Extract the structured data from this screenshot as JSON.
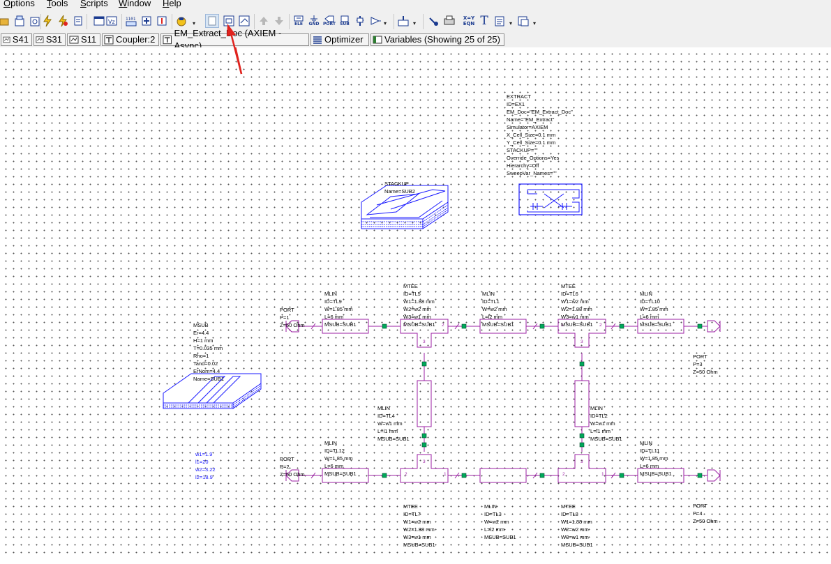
{
  "menu": [
    "Options",
    "Tools",
    "Scripts",
    "Window",
    "Help"
  ],
  "toolbar": {
    "ele_label": "ELE",
    "gnd_label": "GND",
    "port_label": "PORT",
    "sub_label": "SUB",
    "eqn_label": "X=Y\nEQN",
    "text_label": "T"
  },
  "tabs": [
    {
      "label": "S41"
    },
    {
      "label": "S31"
    },
    {
      "label": "S11"
    },
    {
      "label": "Coupler:2"
    },
    {
      "label": "EM_Extract_Doc (AXIEM - Async)"
    },
    {
      "label": "Optimizer"
    },
    {
      "label": "Variables (Showing 25 of 25)"
    }
  ],
  "colors": {
    "wire": "#9b1fa3",
    "node": "#00a85a",
    "em": "#1a1aff",
    "arrow": "#e0231e"
  },
  "schematic": {
    "extract": [
      "EXTRACT",
      "ID=EX1",
      "EM_Doc=\"EM_Extract_Doc\"",
      "Name=\"EM_Extract\"",
      "Simulator=AXIEM",
      "X_Cell_Size=0.1 mm",
      "Y_Cell_Size=0.1 mm",
      "STACKUP=\"\"",
      "Override_Options=Yes",
      "Hierarchy=Off",
      "SweepVar_Names=\"\""
    ],
    "stackup": [
      "STACKUP",
      "Name=SUB2"
    ],
    "msub": [
      "MSUB",
      "Er=4.4",
      "H=1 mm",
      "T=0.035 mm",
      "Rho=1",
      "Tand=0.02",
      "ErNom=4.4",
      "Name=SUB1"
    ],
    "vars": [
      "w1=1.9",
      "l1=20",
      "w2=3.22",
      "l2=18.9"
    ],
    "port1": [
      "PORT",
      "P=1",
      "Z=50 Ohm"
    ],
    "port2": [
      "PORT",
      "P=2",
      "Z=50 Ohm"
    ],
    "port3": [
      "PORT",
      "P=3",
      "Z=50 Ohm"
    ],
    "port4": [
      "PORT",
      "P=4",
      "Z=50 Ohm"
    ],
    "tl9": [
      "MLIN",
      "ID=TL9",
      "W=1.85 mm",
      "L=6 mm",
      "MSUB=SUB1"
    ],
    "tl5": [
      "MTEE",
      "ID=TL5",
      "W1=1.88 mm",
      "W2=w2 mm",
      "W3=w1 mm",
      "MSUB=SUB1"
    ],
    "tl1": [
      "MLIN",
      "ID=TL1",
      "W=w2 mm",
      "L=l2 mm",
      "MSUB=SUB1"
    ],
    "tl6": [
      "MTEE",
      "ID=TL6",
      "W1=w2 mm",
      "W2=1.88 mm",
      "W3=w1 mm",
      "MSUB=SUB1"
    ],
    "tl10": [
      "MLIN",
      "ID=TL10",
      "W=1.85 mm",
      "L=6 mm",
      "MSUB=SUB1"
    ],
    "tl4": [
      "MLIN",
      "ID=TL4",
      "W=w1 mm",
      "L=l1 mm",
      "MSUB=SUB1"
    ],
    "tl2": [
      "MLIN",
      "ID=TL2",
      "W=w1 mm",
      "L=l1 mm",
      "MSUB=SUB1"
    ],
    "tl12": [
      "MLIN",
      "ID=TL12",
      "W=1.85 mm",
      "L=6 mm",
      "MSUB=SUB1"
    ],
    "tl11": [
      "MLIN",
      "ID=TL11",
      "W=1.85 mm",
      "L=6 mm",
      "MSUB=SUB1"
    ],
    "tl7": [
      "MTEE",
      "ID=TL7",
      "W1=w2 mm",
      "W2=1.88 mm",
      "W3=w1 mm",
      "MSUB=SUB1"
    ],
    "tl3": [
      "MLIN",
      "ID=TL3",
      "W=w2 mm",
      "L=l2 mm",
      "MSUB=SUB1"
    ],
    "tl8": [
      "MTEE",
      "ID=TL8",
      "W1=1.88 mm",
      "W2=w2 mm",
      "W3=w1 mm",
      "MSUB=SUB1"
    ],
    "pin_1": "1",
    "pin_2": "2",
    "pin_3": "3"
  }
}
